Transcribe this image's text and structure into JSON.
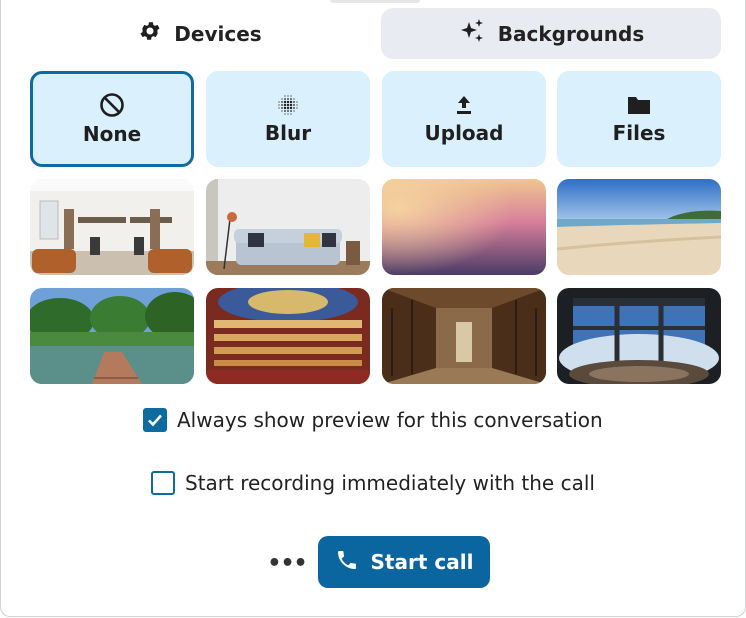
{
  "tabs": {
    "devices": {
      "label": "Devices",
      "icon": "gear-icon"
    },
    "backgrounds": {
      "label": "Backgrounds",
      "icon": "sparkles-icon",
      "active": true
    }
  },
  "options": [
    {
      "label": "None",
      "icon": "no-symbol-icon",
      "selected": true
    },
    {
      "label": "Blur",
      "icon": "blur-icon"
    },
    {
      "label": "Upload",
      "icon": "upload-icon"
    },
    {
      "label": "Files",
      "icon": "folder-icon"
    }
  ],
  "backgrounds": [
    "office",
    "living-room",
    "gradient",
    "beach",
    "park",
    "theater",
    "library",
    "space-station"
  ],
  "checkboxes": {
    "preview": {
      "label": "Always show preview for this conversation",
      "checked": true
    },
    "recording": {
      "label": "Start recording immediately with the call",
      "checked": false
    }
  },
  "actions": {
    "more_label": "•••",
    "start_call_label": "Start call"
  },
  "colors": {
    "primary": "#0b66a0",
    "tile_bg": "#daf0fd",
    "tab_active_bg": "#e8ecf2"
  }
}
